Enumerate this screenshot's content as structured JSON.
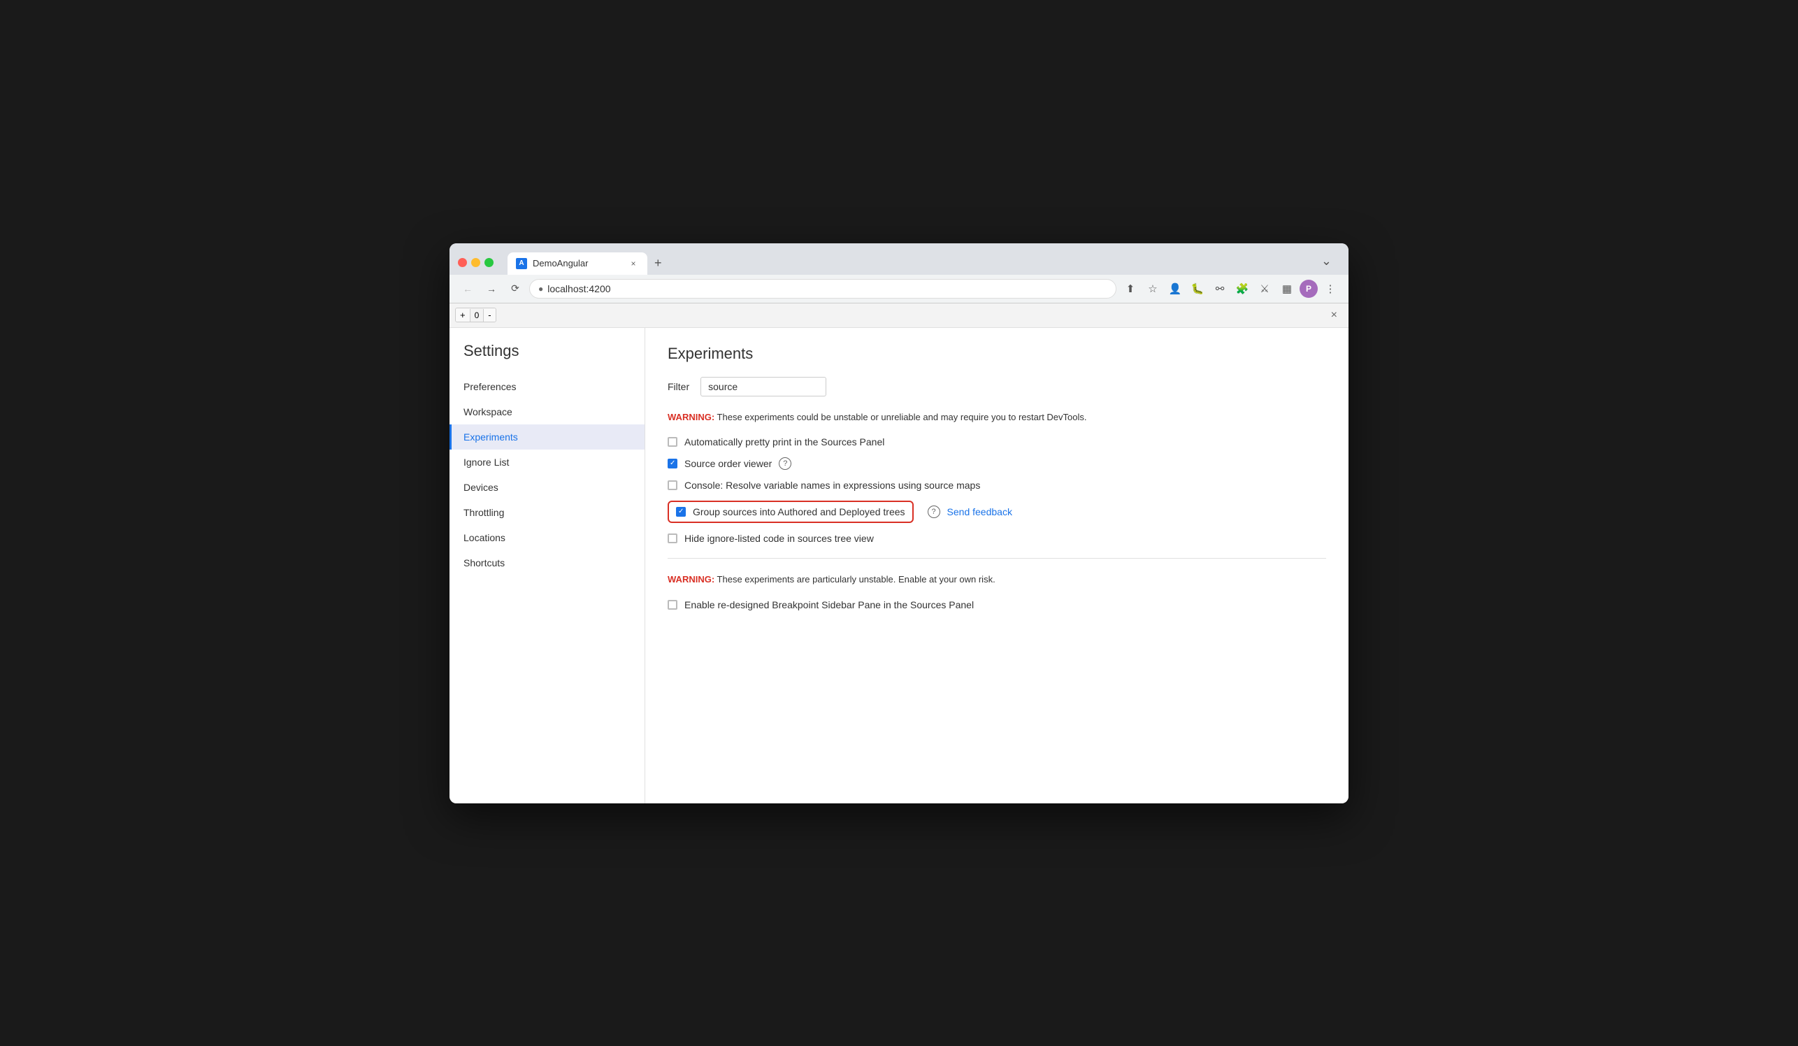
{
  "browser": {
    "tab_title": "DemoAngular",
    "tab_favicon_letter": "A",
    "address": "localhost:4200",
    "zoom_value": "0",
    "new_tab_symbol": "+",
    "close_symbol": "×",
    "chevron_down": "⌄"
  },
  "settings": {
    "title": "Settings",
    "sidebar_items": [
      {
        "id": "preferences",
        "label": "Preferences",
        "active": false
      },
      {
        "id": "workspace",
        "label": "Workspace",
        "active": false
      },
      {
        "id": "experiments",
        "label": "Experiments",
        "active": true
      },
      {
        "id": "ignore-list",
        "label": "Ignore List",
        "active": false
      },
      {
        "id": "devices",
        "label": "Devices",
        "active": false
      },
      {
        "id": "throttling",
        "label": "Throttling",
        "active": false
      },
      {
        "id": "locations",
        "label": "Locations",
        "active": false
      },
      {
        "id": "shortcuts",
        "label": "Shortcuts",
        "active": false
      }
    ]
  },
  "experiments": {
    "title": "Experiments",
    "filter_label": "Filter",
    "filter_value": "source",
    "filter_placeholder": "",
    "warning1_prefix": "WARNING:",
    "warning1_text": " These experiments could be unstable or unreliable and may require you to restart DevTools.",
    "items": [
      {
        "id": "pretty-print",
        "label": "Automatically pretty print in the Sources Panel",
        "checked": false,
        "highlighted": false,
        "has_help": false
      },
      {
        "id": "source-order-viewer",
        "label": "Source order viewer",
        "checked": true,
        "highlighted": false,
        "has_help": true
      },
      {
        "id": "console-resolve",
        "label": "Console: Resolve variable names in expressions using source maps",
        "checked": false,
        "highlighted": false,
        "has_help": false
      },
      {
        "id": "group-sources",
        "label": "Group sources into Authored and Deployed trees",
        "checked": true,
        "highlighted": true,
        "has_help": true,
        "feedback_link": "Send feedback"
      },
      {
        "id": "hide-ignore",
        "label": "Hide ignore-listed code in sources tree view",
        "checked": false,
        "highlighted": false,
        "has_help": false
      }
    ],
    "warning2_prefix": "WARNING:",
    "warning2_text": " These experiments are particularly unstable. Enable at your own risk.",
    "unstable_items": [
      {
        "id": "breakpoint-sidebar",
        "label": "Enable re-designed Breakpoint Sidebar Pane in the Sources Panel",
        "checked": false
      }
    ]
  }
}
